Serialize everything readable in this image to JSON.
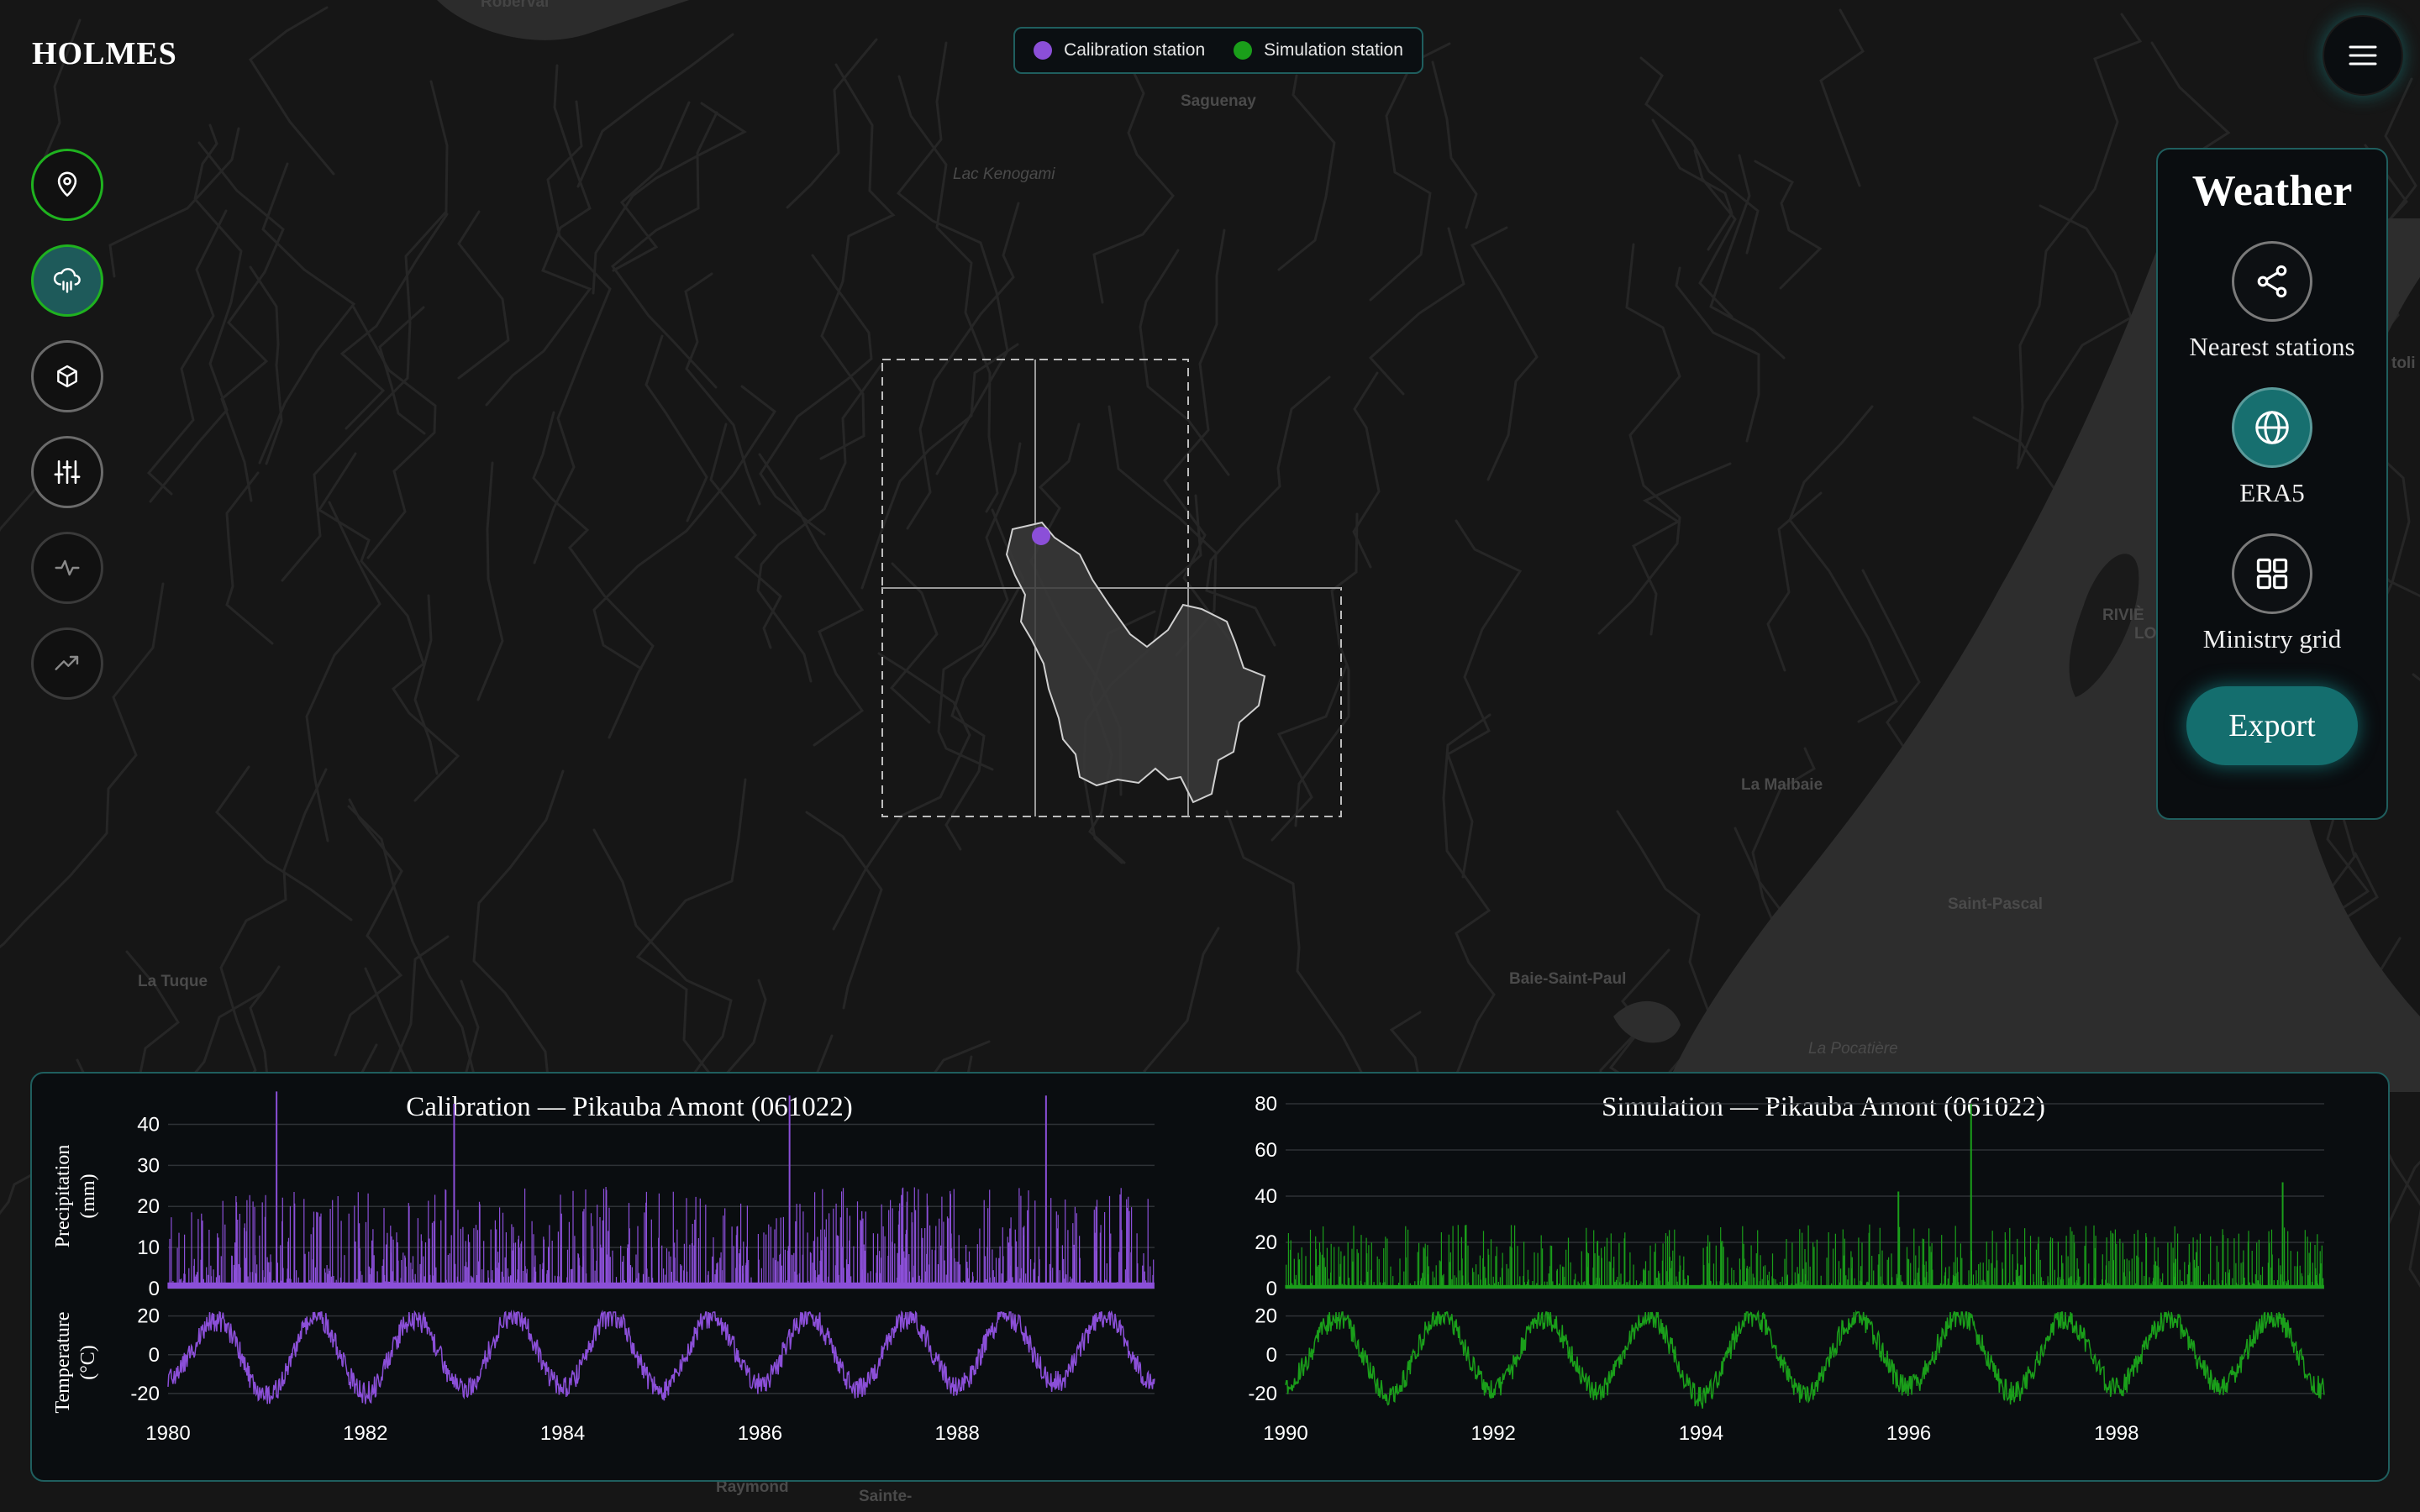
{
  "app": {
    "title": "HOLMES"
  },
  "legend": {
    "items": [
      {
        "label": "Calibration station",
        "color": "#8b4fd8"
      },
      {
        "label": "Simulation station",
        "color": "#1a9e1a"
      }
    ]
  },
  "map": {
    "place_labels": [
      "Roberval",
      "Saguenay",
      "Lac Kenogami",
      "La Tuque",
      "Baie-Saint-Paul",
      "La Malbaie",
      "Saint-Pascal",
      "La Pocatière",
      "RIVIÈ",
      "LO",
      "Raymond",
      "Sainte-",
      "toli"
    ]
  },
  "sidebar": {
    "items": [
      {
        "name": "location",
        "icon": "map-pin-icon",
        "state": "active-outline"
      },
      {
        "name": "weather",
        "icon": "cloud-rain-icon",
        "state": "active-fill"
      },
      {
        "name": "model",
        "icon": "cube-icon",
        "state": "normal"
      },
      {
        "name": "parameters",
        "icon": "sliders-icon",
        "state": "normal"
      },
      {
        "name": "hydrograph",
        "icon": "pulse-icon",
        "state": "dim"
      },
      {
        "name": "trend",
        "icon": "trend-up-icon",
        "state": "dim"
      }
    ]
  },
  "weather_panel": {
    "title": "Weather",
    "options": [
      {
        "label": "Nearest stations",
        "icon": "share-nodes-icon",
        "selected": false
      },
      {
        "label": "ERA5",
        "icon": "globe-icon",
        "selected": true
      },
      {
        "label": "Ministry grid",
        "icon": "grid-icon",
        "selected": false
      }
    ],
    "export_label": "Export"
  },
  "menu": {
    "icon": "hamburger-menu-icon"
  },
  "chart_data": [
    {
      "type": "bar",
      "title": "Calibration — Pikauba Amont (061022)",
      "subplots": [
        {
          "ylabel": "Precipitation (mm)",
          "yticks": [
            0,
            10,
            20,
            30,
            40
          ],
          "ylim": [
            0,
            45
          ]
        },
        {
          "ylabel": "Temperature (°C)",
          "yticks": [
            -20,
            0,
            20
          ],
          "ylim": [
            -30,
            22
          ]
        }
      ],
      "xticks": [
        "1980",
        "1982",
        "1984",
        "1986",
        "1988"
      ],
      "xlim": [
        1980,
        1990
      ],
      "color": "#8b4fd8",
      "series": [
        {
          "x": [
            1980.0,
            1980.5,
            1981.0,
            1981.5,
            1982.0,
            1982.5,
            1983.0,
            1983.5,
            1984.0,
            1984.5,
            1985.0,
            1985.5,
            1986.0,
            1986.5,
            1987.0,
            1987.5,
            1988.0,
            1988.5,
            1989.0,
            1989.5,
            1990.0
          ],
          "values": [
            -12,
            18,
            -22,
            20,
            -20,
            19,
            -18,
            21,
            -17,
            20,
            -19,
            19,
            -15,
            20,
            -18,
            19,
            -16,
            20,
            -14,
            20,
            -15
          ]
        }
      ],
      "precip_peaks": [
        {
          "x": 1981.1,
          "value": 48
        },
        {
          "x": 1982.9,
          "value": 45
        },
        {
          "x": 1986.3,
          "value": 47
        },
        {
          "x": 1988.9,
          "value": 47
        }
      ]
    },
    {
      "type": "bar",
      "title": "Simulation — Pikauba Amont (061022)",
      "subplots": [
        {
          "ylabel": "",
          "yticks": [
            0,
            20,
            40,
            60,
            80
          ],
          "ylim": [
            0,
            80
          ]
        },
        {
          "ylabel": "",
          "yticks": [
            -20,
            0,
            20
          ],
          "ylim": [
            -30,
            22
          ]
        }
      ],
      "xticks": [
        "1990",
        "1992",
        "1994",
        "1996",
        "1998"
      ],
      "xlim": [
        1990,
        2000
      ],
      "color": "#1a9e1a",
      "series": [
        {
          "x": [
            1990.0,
            1990.5,
            1991.0,
            1991.5,
            1992.0,
            1992.5,
            1993.0,
            1993.5,
            1994.0,
            1994.5,
            1995.0,
            1995.5,
            1996.0,
            1996.5,
            1997.0,
            1997.5,
            1998.0,
            1998.5,
            1999.0,
            1999.5,
            2000.0
          ],
          "values": [
            -15,
            19,
            -20,
            20,
            -18,
            19,
            -19,
            20,
            -22,
            20,
            -20,
            19,
            -17,
            20,
            -20,
            19,
            -17,
            19,
            -16,
            20,
            -18
          ]
        }
      ],
      "precip_peaks": [
        {
          "x": 1995.9,
          "value": 42
        },
        {
          "x": 1996.6,
          "value": 80
        },
        {
          "x": 1999.6,
          "value": 46
        }
      ]
    }
  ]
}
